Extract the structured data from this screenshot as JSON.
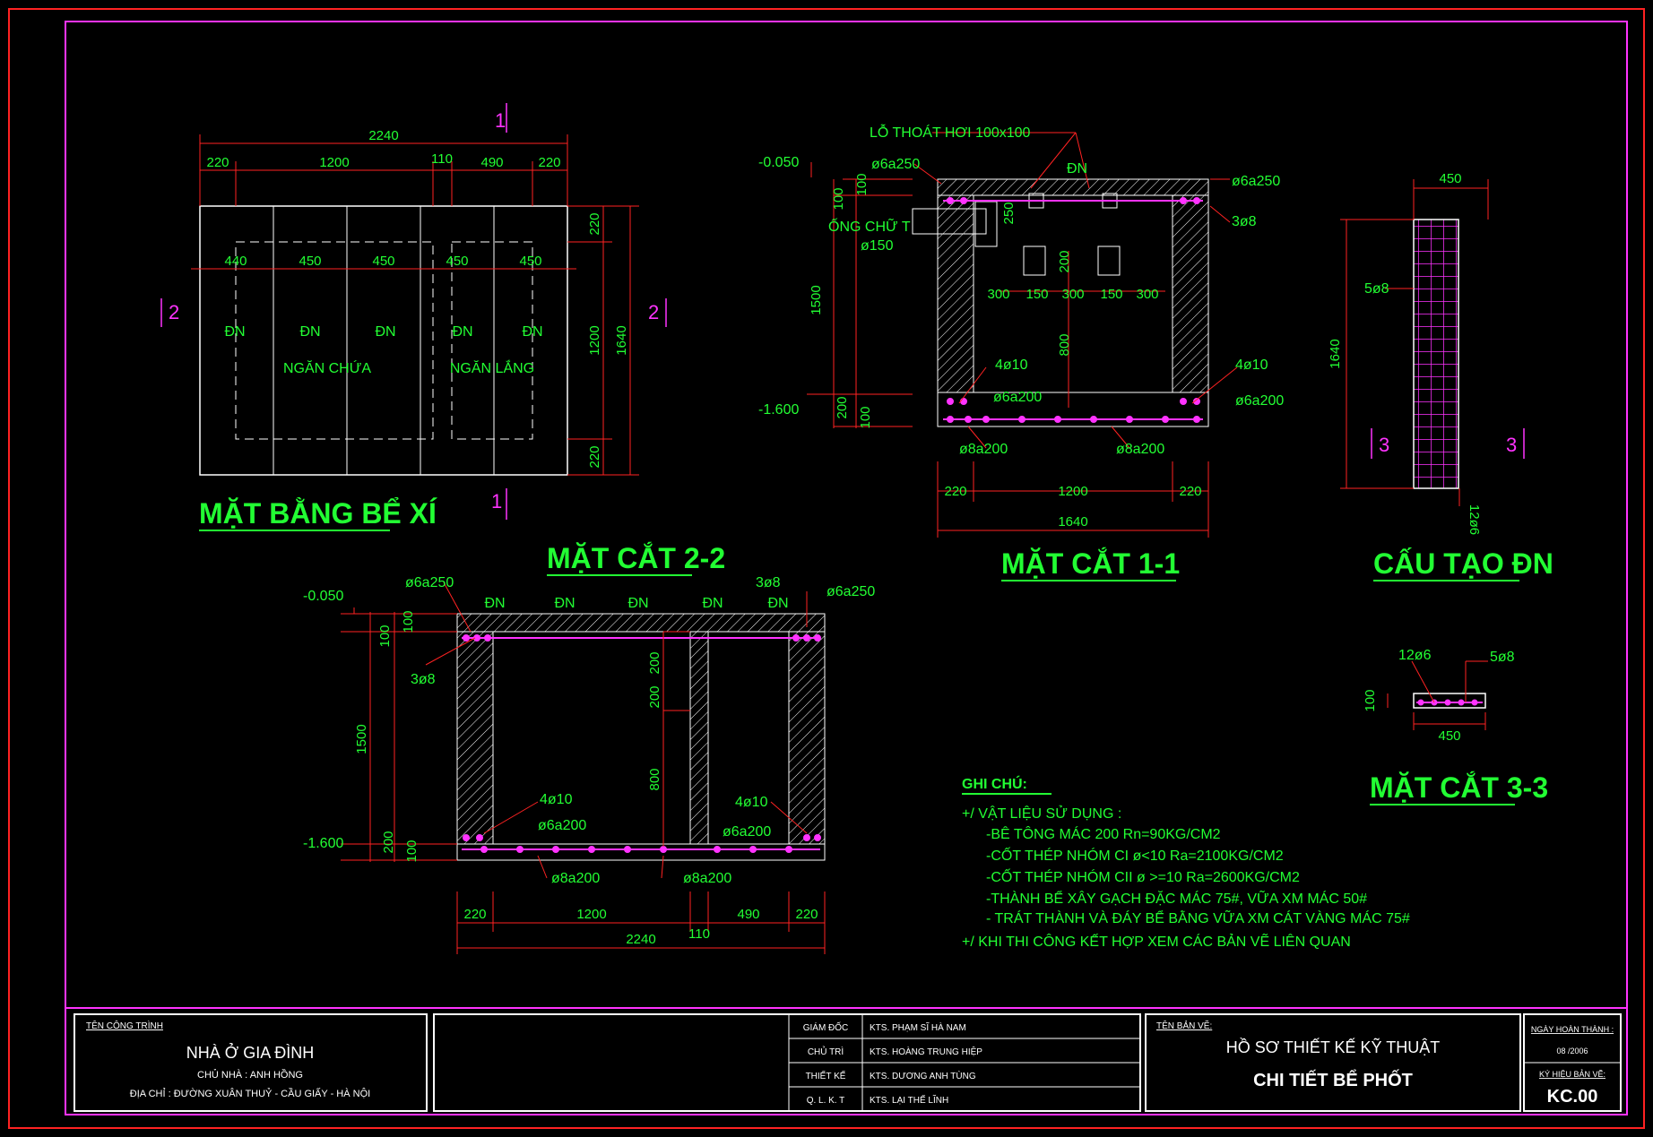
{
  "plan": {
    "title": "MẶT BẰNG BỂ XÍ",
    "dim_total": "2240",
    "dims_top": [
      "220",
      "1200",
      "110",
      "490",
      "220"
    ],
    "dims_inner": [
      "440",
      "450",
      "450",
      "450",
      "450"
    ],
    "dims_right": [
      "220",
      "1200",
      "220"
    ],
    "dim_right_total": "1640",
    "dn_labels": [
      "ĐN",
      "ĐN",
      "ĐN",
      "ĐN",
      "ĐN"
    ],
    "chamber_store": "NGĂN CHỨA",
    "chamber_settle": "NGĂN LẮNG",
    "section_marks": [
      "1",
      "1",
      "2",
      "2"
    ]
  },
  "section11": {
    "title": "MẶT CẮT 1-1",
    "vent_label": "LỖ THOÁT HƠI 100x100",
    "dn_label": "ĐN",
    "elev_top": "-0.050",
    "elev_bottom": "-1.600",
    "rebar_top_left": "ø6a250",
    "rebar_top_right": "ø6a250",
    "rebar_3": "3ø8",
    "pipe_label": "ỐNG CHỮ T",
    "pipe_dia": "ø150",
    "dim_250": "250",
    "dim_200": "200",
    "dims_openings": [
      "300",
      "150",
      "300",
      "150",
      "300"
    ],
    "dim_800": "800",
    "left_dims": [
      "100",
      "100",
      "1500",
      "200",
      "100"
    ],
    "rebar_4_left": "4ø10",
    "rebar_4_right": "4ø10",
    "rebar_bot_left": "ø6a200",
    "rebar_bot_right": "ø6a200",
    "rebar_base_left": "ø8a200",
    "rebar_base_right": "ø8a200",
    "dims_bottom": [
      "220",
      "1200",
      "220"
    ],
    "dim_bottom_total": "1640"
  },
  "dn_detail": {
    "title": "CẤU TẠO ĐN",
    "width": "450",
    "height": "1640",
    "rebar_side": "5ø8",
    "rebar_long": "12ø6",
    "section_marks": [
      "3",
      "3"
    ]
  },
  "section22": {
    "title": "MẶT CẮT 2-2",
    "elev_top": "-0.050",
    "elev_bottom": "-1.600",
    "rebar_top_left": "ø6a250",
    "rebar_top_right": "ø6a250",
    "rebar_3_left": "3ø8",
    "rebar_3_right": "3ø8",
    "dn_labels": [
      "ĐN",
      "ĐN",
      "ĐN",
      "ĐN",
      "ĐN"
    ],
    "left_dims": [
      "100",
      "100",
      "1500",
      "200",
      "100"
    ],
    "mid_dims": [
      "200",
      "200",
      "800"
    ],
    "rebar_4_left": "4ø10",
    "rebar_4_right": "4ø10",
    "rebar_bot_left": "ø6a200",
    "rebar_bot_right": "ø6a200",
    "rebar_base_left": "ø8a200",
    "rebar_base_right": "ø8a200",
    "dims_bottom": [
      "220",
      "1200",
      "490",
      "220"
    ],
    "dim_110": "110",
    "dim_total": "2240"
  },
  "section33": {
    "title": "MẶT CẮT 3-3",
    "rebar_left": "12ø6",
    "rebar_right": "5ø8",
    "height": "100",
    "width": "450"
  },
  "notes": {
    "heading": "GHI CHÚ:",
    "lines": [
      "+/ VẬT LIỆU SỬ DỤNG :",
      "-BÊ TÔNG MÁC 200 Rn=90KG/CM2",
      "-CỐT THÉP NHÓM CI ø<10 Ra=2100KG/CM2",
      "-CỐT THÉP NHÓM CII ø >=10 Ra=2600KG/CM2",
      "-THÀNH BỂ XÂY GẠCH ĐẶC MÁC 75#, VỮA XM MÁC 50#",
      "- TRÁT THÀNH VÀ ĐÁY BỂ BẰNG VỮA XM CÁT VÀNG MÁC 75#",
      "+/ KHI THI CÔNG KẾT HỢP XEM CÁC BẢN VẼ LIÊN QUAN"
    ]
  },
  "title_block": {
    "project_label": "TÊN CÔNG TRÌNH",
    "project_name": "NHÀ Ở GIA ĐÌNH",
    "owner": "CHỦ NHÀ : ANH HỒNG",
    "address": "ĐỊA CHỈ : ĐƯỜNG XUÂN THUỶ - CẦU GIẤY - HÀ NỘI",
    "roles": [
      {
        "role": "GIÁM ĐỐC",
        "name": "KTS. PHẠM SĨ HÀ NAM"
      },
      {
        "role": "CHỦ TRÌ",
        "name": "KTS. HOÀNG TRUNG HIỆP"
      },
      {
        "role": "THIẾT KẾ",
        "name": "KTS. DƯƠNG ANH TÙNG"
      },
      {
        "role": "Q. L. K. T",
        "name": "KTS. LẠI THẾ LĨNH"
      }
    ],
    "drawing_label": "TÊN BẢN VẼ:",
    "drawing_line1": "HỒ SƠ THIẾT KẾ KỸ THUẬT",
    "drawing_line2": "CHI TIẾT BỂ PHỐT",
    "date_label": "NGÀY HOÀN THÀNH :",
    "date": "08 /2006",
    "code_label": "KÝ HIỆU BẢN VẼ:",
    "code": "KC.00"
  },
  "colors": {
    "dim": "#ff2222",
    "text": "#22ff33",
    "rebar": "#ff33ff",
    "frame": "#ff33ff",
    "outline": "#ffffff"
  }
}
